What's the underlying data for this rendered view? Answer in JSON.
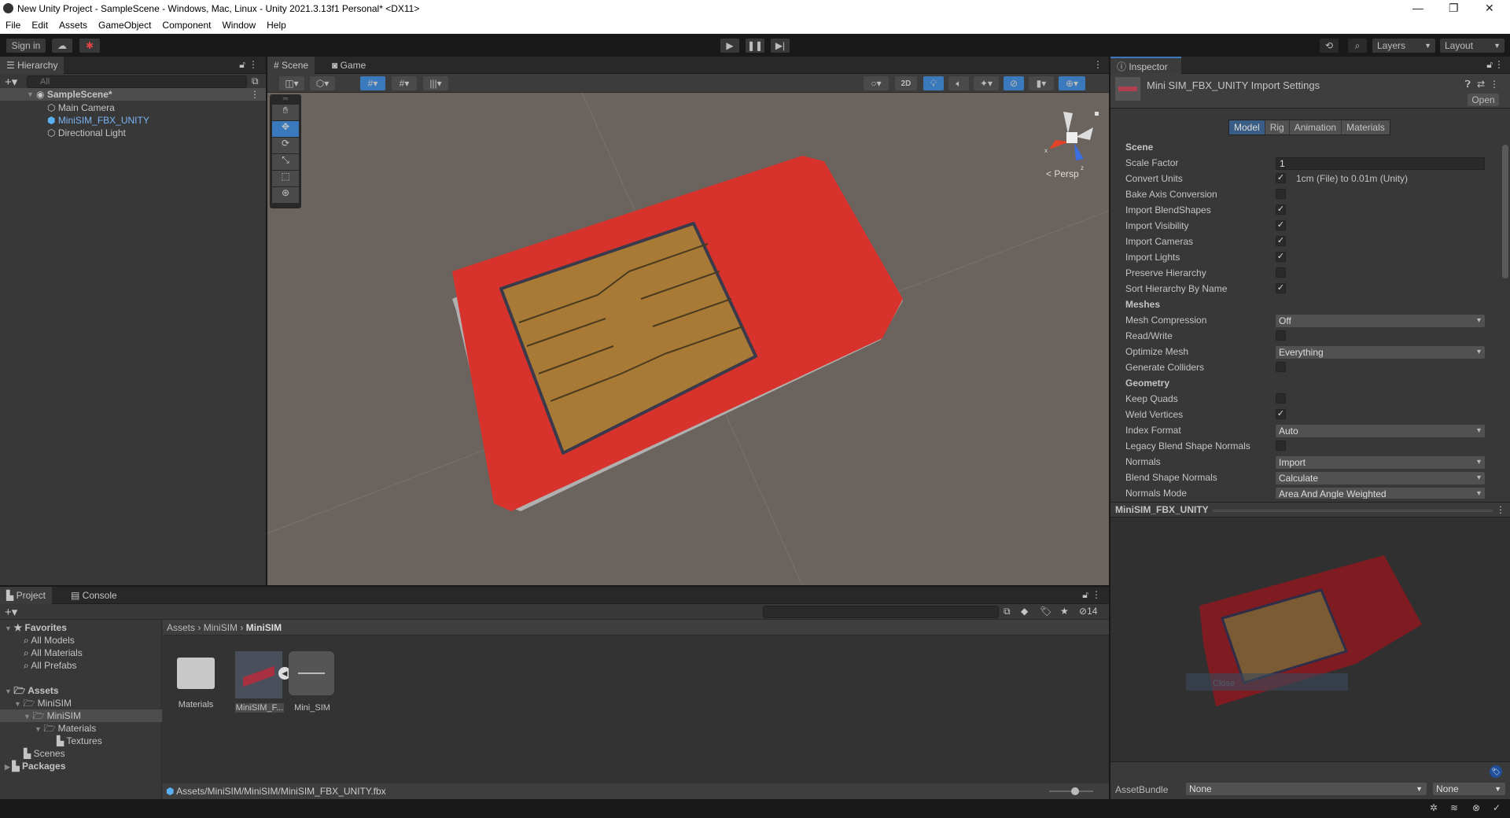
{
  "window": {
    "title": "New Unity Project - SampleScene - Windows, Mac, Linux - Unity 2021.3.13f1 Personal* <DX11>"
  },
  "menu": [
    "File",
    "Edit",
    "Assets",
    "GameObject",
    "Component",
    "Window",
    "Help"
  ],
  "toolbar": {
    "sign_in": "Sign in",
    "layers": "Layers",
    "layout": "Layout"
  },
  "hierarchy": {
    "tab": "Hierarchy",
    "search_placeholder": "All",
    "scene": "SampleScene*",
    "items": [
      "Main Camera",
      "MiniSIM_FBX_UNITY",
      "Directional Light"
    ]
  },
  "scene_view": {
    "tabs": [
      "Scene",
      "Game"
    ],
    "btn_2d": "2D",
    "persp": "< Persp",
    "axis_x": "x",
    "axis_z": "z"
  },
  "inspector": {
    "tab": "Inspector",
    "title": "Mini SIM_FBX_UNITY Import Settings",
    "open": "Open",
    "tabs": [
      "Model",
      "Rig",
      "Animation",
      "Materials"
    ],
    "rows": [
      {
        "type": "header",
        "label": "Scene"
      },
      {
        "type": "field",
        "label": "Scale Factor",
        "value": "1"
      },
      {
        "type": "check",
        "label": "Convert Units",
        "checked": true,
        "note": "1cm (File) to 0.01m (Unity)"
      },
      {
        "type": "check",
        "label": "Bake Axis Conversion",
        "checked": false
      },
      {
        "type": "check",
        "label": "Import BlendShapes",
        "checked": true
      },
      {
        "type": "check",
        "label": "Import Visibility",
        "checked": true
      },
      {
        "type": "check",
        "label": "Import Cameras",
        "checked": true
      },
      {
        "type": "check",
        "label": "Import Lights",
        "checked": true
      },
      {
        "type": "check",
        "label": "Preserve Hierarchy",
        "checked": false
      },
      {
        "type": "check",
        "label": "Sort Hierarchy By Name",
        "checked": true
      },
      {
        "type": "header",
        "label": "Meshes"
      },
      {
        "type": "dropdown",
        "label": "Mesh Compression",
        "value": "Off"
      },
      {
        "type": "check",
        "label": "Read/Write",
        "checked": false
      },
      {
        "type": "dropdown",
        "label": "Optimize Mesh",
        "value": "Everything"
      },
      {
        "type": "check",
        "label": "Generate Colliders",
        "checked": false
      },
      {
        "type": "header",
        "label": "Geometry"
      },
      {
        "type": "check",
        "label": "Keep Quads",
        "checked": false
      },
      {
        "type": "check",
        "label": "Weld Vertices",
        "checked": true
      },
      {
        "type": "dropdown",
        "label": "Index Format",
        "value": "Auto"
      },
      {
        "type": "check",
        "label": "Legacy Blend Shape Normals",
        "checked": false
      },
      {
        "type": "dropdown",
        "label": "Normals",
        "value": "Import"
      },
      {
        "type": "dropdown",
        "label": "Blend Shape Normals",
        "value": "Calculate"
      },
      {
        "type": "dropdown",
        "label": "Normals Mode",
        "value": "Area And Angle Weighted"
      }
    ],
    "preview_title": "MiniSIM_FBX_UNITY",
    "preview_overlay": "Close",
    "assetbundle_label": "AssetBundle",
    "assetbundle_value": "None",
    "assetbundle_variant": "None"
  },
  "project": {
    "tabs": [
      "Project",
      "Console"
    ],
    "favorites": {
      "label": "Favorites",
      "items": [
        "All Models",
        "All Materials",
        "All Prefabs"
      ]
    },
    "tree": [
      {
        "label": "Assets",
        "level": 0,
        "bold": true
      },
      {
        "label": "MiniSIM",
        "level": 1
      },
      {
        "label": "MiniSIM",
        "level": 2,
        "selected": true
      },
      {
        "label": "Materials",
        "level": 3
      },
      {
        "label": "Textures",
        "level": 4
      },
      {
        "label": "Scenes",
        "level": 1
      },
      {
        "label": "Packages",
        "level": 0,
        "bold": true
      }
    ],
    "breadcrumb": [
      "Assets",
      "MiniSIM",
      "MiniSIM"
    ],
    "assets": [
      "Materials",
      "MiniSIM_F...",
      "Mini_SIM"
    ],
    "hidden_count": "14",
    "path": "Assets/MiniSIM/MiniSIM/MiniSIM_FBX_UNITY.fbx",
    "zoom_slider": 0.6
  },
  "colors": {
    "accent": "#3a79bb",
    "scene_bg": "#6b635d",
    "sim_red": "#d8322c",
    "chip_gold": "#a87a35"
  }
}
